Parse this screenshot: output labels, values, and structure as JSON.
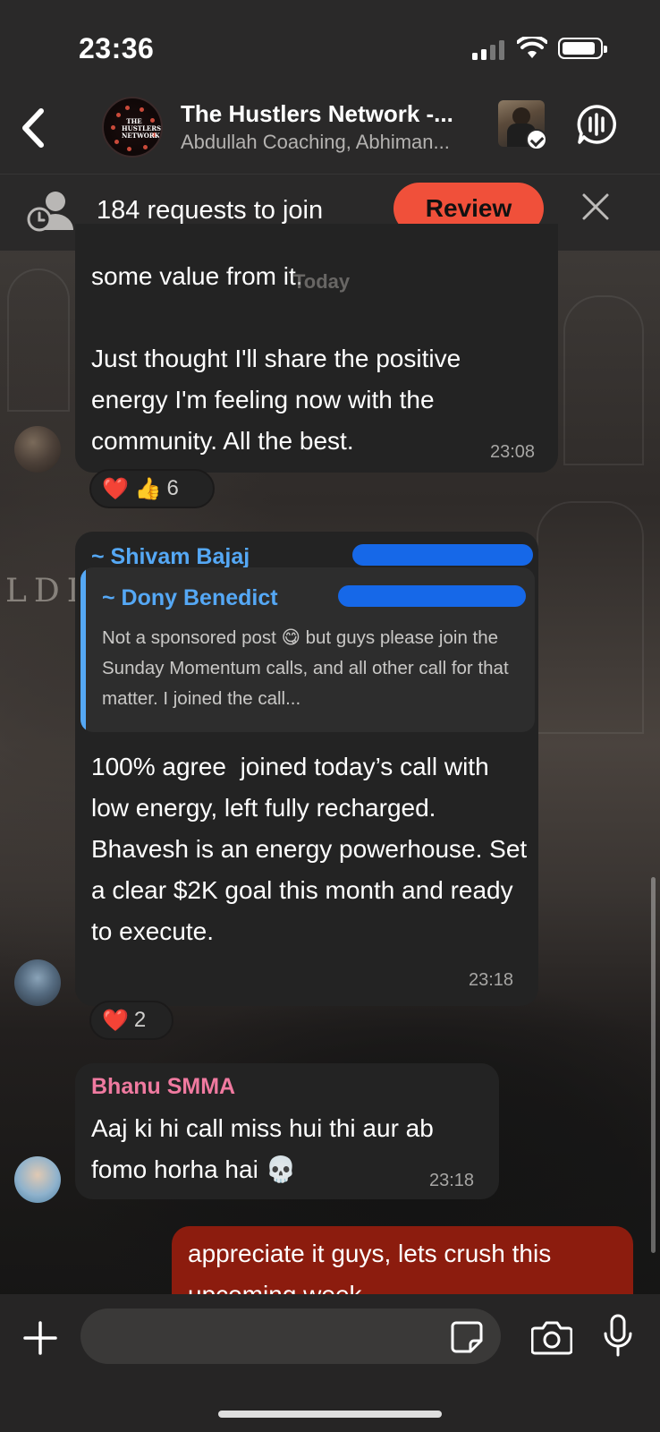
{
  "status_bar": {
    "time": "23:36"
  },
  "header": {
    "title": "The Hustlers Network -...",
    "subtitle": "Abdullah Coaching, Abhiman...",
    "group_avatar_text": "THE HUSTLERS NETWORK"
  },
  "join_banner": {
    "text": "184 requests to join",
    "review_label": "Review"
  },
  "chat": {
    "date_pill": "Today",
    "messages": [
      {
        "text": "some value from it.\n\nJust thought I'll share the positive energy I'm feeling now with the community. All the best.",
        "time": "23:08",
        "reactions": {
          "emojis": "❤️ 👍",
          "count": "6"
        }
      },
      {
        "sender": "~ Shivam Bajaj",
        "sender_color": "#55a8f5",
        "quote": {
          "sender": "~ Dony Benedict",
          "text": "Not a sponsored post 😋 but guys please join the Sunday Momentum calls,  and all other call for that matter. I joined the call..."
        },
        "text": "100% agree  joined today’s call with low energy, left fully recharged. Bhavesh is an energy powerhouse. Set a clear $2K goal this month and ready to execute.",
        "time": "23:18",
        "reactions": {
          "emojis": "❤️",
          "count": "2"
        }
      },
      {
        "sender": "Bhanu SMMA",
        "sender_color": "#f07aa0",
        "text": "Aaj ki hi call miss hui thi aur ab fomo horha hai 💀",
        "time": "23:18"
      }
    ],
    "own_message": {
      "text": "appreciate it guys, lets crush this upcoming week"
    }
  },
  "input_bar": {
    "placeholder": ""
  },
  "colors": {
    "accent_review": "#f0503a",
    "own_bubble": "#8c1c0e",
    "link_blue": "#55a8f5",
    "sender_pink": "#f07aa0"
  }
}
